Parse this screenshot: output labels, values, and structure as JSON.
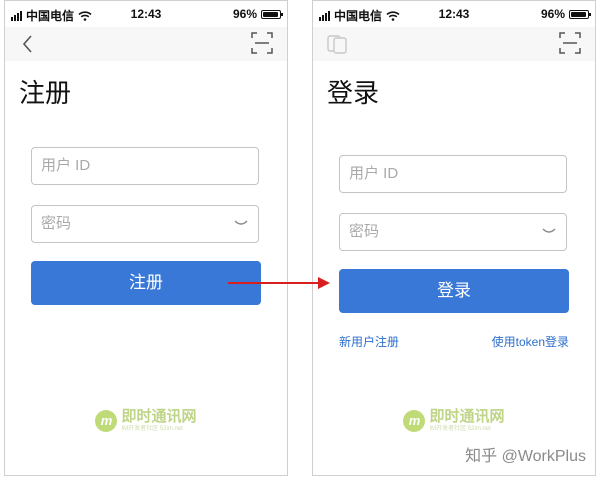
{
  "status_bar": {
    "carrier": "中国电信",
    "time": "12:43",
    "battery": "96%",
    "battery_level": 0.96
  },
  "register_screen": {
    "title": "注册",
    "username_placeholder": "用户 ID",
    "password_placeholder": "密码",
    "submit_label": "注册",
    "icons": [
      "back-icon",
      "scan-icon",
      "eye-closed-icon"
    ]
  },
  "login_screen": {
    "title": "登录",
    "username_placeholder": "用户 ID",
    "password_placeholder": "密码",
    "submit_label": "登录",
    "register_link": "新用户注册",
    "token_link": "使用token登录",
    "icons": [
      "document-icon",
      "scan-icon",
      "eye-closed-icon"
    ]
  },
  "watermark": {
    "logo_letter": "m",
    "title": "即时通讯网",
    "subtitle": "IM开发者社区 52im.net"
  },
  "credit": "知乎 @WorkPlus",
  "colors": {
    "primary": "#3a78d8",
    "link": "#2c6fcc",
    "arrow": "#d81e1e"
  }
}
